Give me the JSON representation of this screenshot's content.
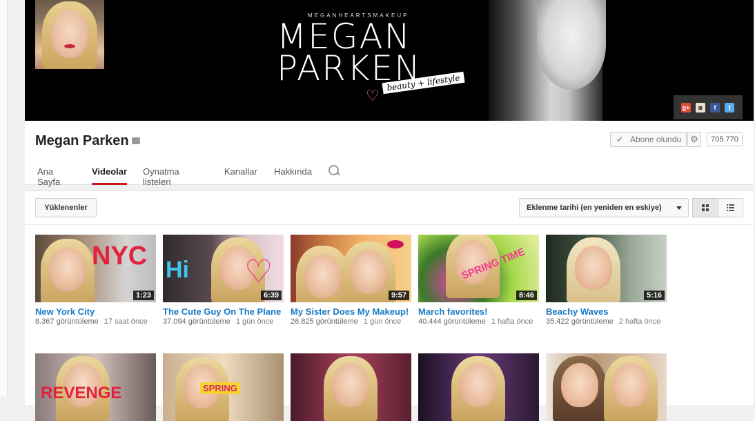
{
  "banner": {
    "small_text": "MEGANHEARTSMAKEUP",
    "title_line1": "MEGAN",
    "title_line2": "PARKEN",
    "tagline": "beauty + lifestyle",
    "social_icons": [
      "google-plus-icon",
      "instagram-icon",
      "facebook-icon",
      "twitter-icon"
    ]
  },
  "channel": {
    "name": "Megan Parken",
    "subscribe_label": "Abone olundu",
    "subscriber_count": "705.770"
  },
  "tabs": [
    {
      "label": "Ana Sayfa"
    },
    {
      "label": "Videolar",
      "active": true
    },
    {
      "label": "Oynatma listeleri"
    },
    {
      "label": "Kanallar"
    },
    {
      "label": "Hakkında"
    }
  ],
  "toolbar": {
    "filter_label": "Yüklenenler",
    "sort_label": "Eklenme tarihi (en yeniden en eskiye)",
    "view_mode": "grid"
  },
  "videos": [
    {
      "title": "New York City",
      "views": "8.367 görüntüleme",
      "ago": "17 saat önce",
      "duration": "1:23",
      "overlay": "NYC"
    },
    {
      "title": "The Cute Guy On The Plane",
      "views": "37.094 görüntüleme",
      "ago": "1 gün önce",
      "duration": "6:39",
      "overlay": "Hi"
    },
    {
      "title": "My Sister Does My Makeup!",
      "views": "26.825 görüntüleme",
      "ago": "1 gün önce",
      "duration": "9:57",
      "overlay": ""
    },
    {
      "title": "March favorites!",
      "views": "40.444 görüntüleme",
      "ago": "1 hafta önce",
      "duration": "8:46",
      "overlay": "SPRING TIME"
    },
    {
      "title": "Beachy Waves",
      "views": "35.422 görüntüleme",
      "ago": "2 hafta önce",
      "duration": "5:16",
      "overlay": ""
    }
  ],
  "videos_row2_overlays": [
    "REVENGE",
    "SPRING",
    "",
    "",
    ""
  ],
  "colors": {
    "accent": "#cc181e",
    "link": "#167ac6"
  }
}
